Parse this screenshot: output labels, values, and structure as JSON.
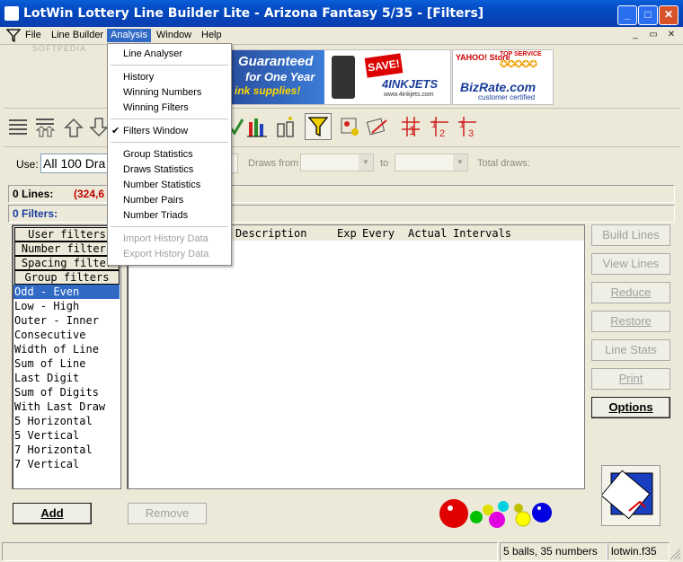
{
  "window": {
    "title": "LotWin Lottery Line Builder Lite - Arizona Fantasy 5/35 - [Filters]",
    "minimize": "_",
    "maximize": "□",
    "close": "✕"
  },
  "menubar": {
    "items": [
      "File",
      "Line Builder",
      "Analysis",
      "Window",
      "Help"
    ],
    "active": "Analysis",
    "mdi_buttons": [
      "_",
      "▭",
      "✕"
    ]
  },
  "analysis_menu": {
    "groups": [
      [
        {
          "label": "Line Analyser",
          "enabled": true
        }
      ],
      [
        {
          "label": "History",
          "enabled": true
        },
        {
          "label": "Winning Numbers",
          "enabled": true
        },
        {
          "label": "Winning Filters",
          "enabled": true
        }
      ],
      [
        {
          "label": "Filters Window",
          "enabled": true,
          "checked": true
        }
      ],
      [
        {
          "label": "Group Statistics",
          "enabled": true
        },
        {
          "label": "Draws Statistics",
          "enabled": true
        },
        {
          "label": "Number Statistics",
          "enabled": true
        },
        {
          "label": "Number Pairs",
          "enabled": true
        },
        {
          "label": "Number Triads",
          "enabled": true
        }
      ],
      [
        {
          "label": "Import History Data",
          "enabled": false
        },
        {
          "label": "Export History Data",
          "enabled": false
        }
      ]
    ]
  },
  "banner": {
    "ad_line1": "Guaranteed",
    "ad_line2": "for One Year",
    "ad_line3": "ink supplies!",
    "save_badge": "SAVE!",
    "brand": "4INKJETS",
    "brand_url": "www.4inkjets.com",
    "yahoo_store": "YAHOO! Store",
    "top_service": "TOP SERVICE",
    "bizrate": "BizRate.com",
    "bizrate_sub": "customer certified"
  },
  "use_row": {
    "use_label": "Use:",
    "use_value": "All 100 Dra",
    "draws_from_label": "Draws from",
    "to_label": "to",
    "total_draws_label": "Total draws:"
  },
  "info": {
    "lines_label": "0 Lines:",
    "lines_count": "(324,6",
    "filters_label": "0 Filters:"
  },
  "filter_buttons": [
    "User filters",
    "Number filters",
    "Spacing filter",
    "Group filters"
  ],
  "filter_list": {
    "items": [
      "Odd - Even",
      "Low - High",
      "Outer - Inner",
      "Consecutive",
      "Width of Line",
      "Sum of Line",
      "Last Digit",
      "Sum of Digits",
      "With Last Draw",
      "5 Horizontal",
      "5 Vertical",
      "7 Horizontal",
      "7 Vertical"
    ],
    "selected": "Odd - Even"
  },
  "grid": {
    "columns": [
      "Description",
      "Exp",
      "Every",
      "Actual",
      "Intervals"
    ]
  },
  "action_buttons": [
    {
      "label": "Build Lines",
      "enabled": false
    },
    {
      "label": "View Lines",
      "enabled": false
    },
    {
      "label": "Reduce",
      "enabled": false
    },
    {
      "label": "Restore",
      "enabled": false
    },
    {
      "label": "Line Stats",
      "enabled": false
    },
    {
      "label": "Print",
      "enabled": false
    },
    {
      "label": "Options",
      "enabled": true
    }
  ],
  "bottom_buttons": {
    "add": "Add",
    "remove": "Remove"
  },
  "balls_colors": [
    "#e00000",
    "#00c000",
    "#e0e000",
    "#00d0e0",
    "#e000e0",
    "#ffff00",
    "#0000e0"
  ],
  "status": {
    "left": "",
    "balls": "5 balls, 35 numbers",
    "file": "lotwin.f35"
  },
  "watermark": "SOFTPEDIA"
}
